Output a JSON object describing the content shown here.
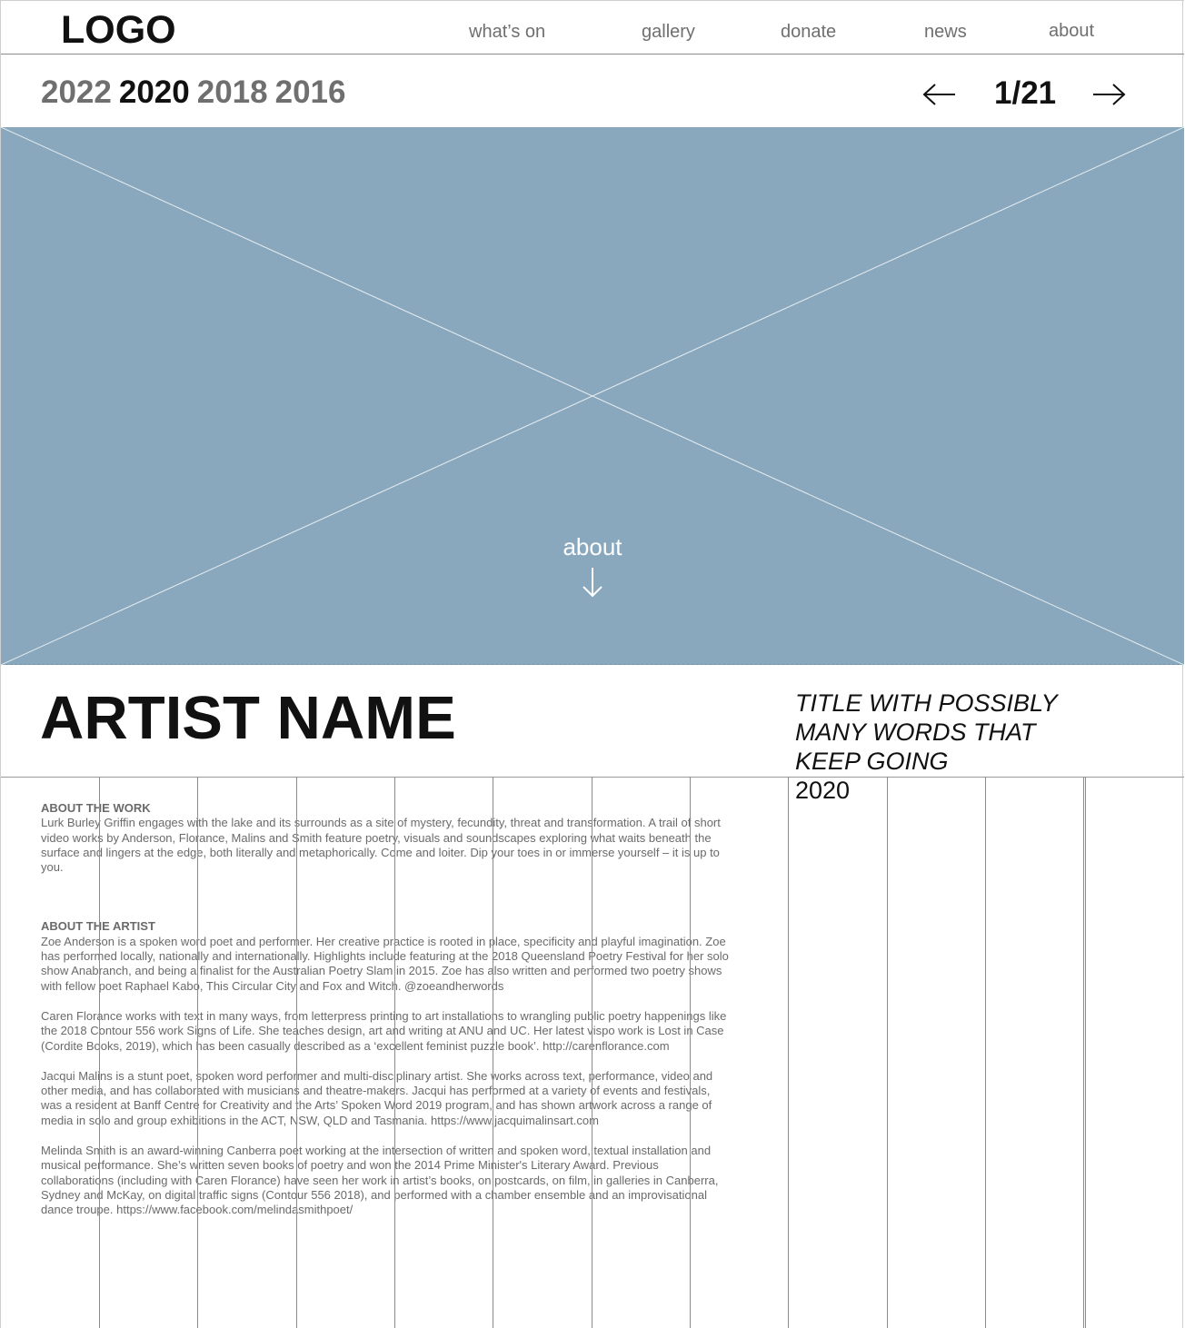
{
  "nav": {
    "logo": "LOGO",
    "items": [
      "what’s on",
      "gallery",
      "donate",
      "news",
      "about"
    ]
  },
  "years": [
    "2022",
    "2020",
    "2018",
    "2016"
  ],
  "active_year": "2020",
  "pager": {
    "current": "1/21",
    "prev_icon": "arrow-left-icon",
    "next_icon": "arrow-right-icon"
  },
  "hero": {
    "about_label": "about",
    "arrow_icon": "arrow-down-icon",
    "placeholder_color": "#89a8bd"
  },
  "artist": {
    "name": "ARTIST NAME",
    "title": "TITLE WITH POSSIBLY MANY WORDS THAT KEEP GOING",
    "year": "2020"
  },
  "about_work": {
    "heading": "ABOUT THE WORK",
    "text": "Lurk Burley Griffin engages with the lake and its surrounds as a site of mystery, fecundity, threat and transformation. A trail of short video works by Anderson, Florance, Malins and Smith feature poetry, visuals and soundscapes exploring what waits beneath the surface and lingers at the edge, both literally and metaphorically. Come and loiter. Dip your toes in or immerse yourself – it is up to you."
  },
  "about_artist": {
    "heading": "ABOUT THE ARTIST",
    "paragraphs": [
      "Zoe Anderson is a spoken word poet and performer. Her creative practice is rooted in place, specificity and playful imagination. Zoe has performed locally, nationally and internationally. Highlights include featuring at the 2018 Queensland Poetry Festival for her solo show Anabranch, and being a finalist   for the Australian Poetry Slam in 2015. Zoe has also written and performed two poetry shows with fellow poet Raphael Kabo, This Circular City and Fox   and Witch. @zoeandherwords",
      "Caren Florance works with text in many ways, from letterpress printing to art installations to wrangling public poetry happenings like the 2018 Contour 556 work Signs of Life. She teaches design, art and writing at ANU and UC. Her latest vispo work is Lost in Case (Cordite Books, 2019), which has been   casually described as a ‘excellent feminist puzzle book’. http://carenflorance.com",
      "Jacqui Malins is a stunt poet, spoken word performer and multi-disciplinary artist. She works across text, performance, video and other media, and has collaborated with musicians and theatre-makers. Jacqui has performed at a variety of events and festivals, was a resident at Banff Centre for Creativity and the Arts’ Spoken Word 2019 program, and has shown artwork across a range of media in solo and group exhibitions in the ACT, NSW, QLD and   Tasmania. https://www.jacquimalinsart.com",
      "Melinda Smith is an award-winning Canberra poet working at the intersection   of written and spoken word, textual installation and musical performance. She’s written seven books of poetry and won the 2014 Prime Minister's Literary Award. Previous collaborations (including with Caren Florance) have  seen her work in artist’s books, on postcards, on film, in galleries in Canberra, Sydney and McKay, on digital traffic signs (Contour 556 2018), and   performed with a chamber ensemble and an improvisational dance troupe.   https://www.facebook.com/melindasmithpoet/"
    ]
  }
}
